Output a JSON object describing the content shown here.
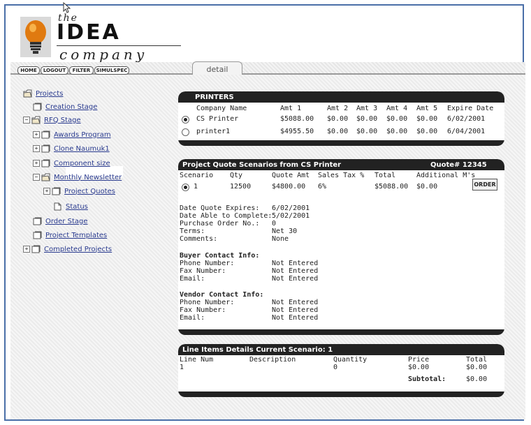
{
  "logo": {
    "the": "the",
    "idea": "IDEA",
    "company": "company"
  },
  "nav": {
    "buttons": [
      "HOME",
      "LOGOUT",
      "FILTER",
      "SIMULSPEC"
    ],
    "tab": "detail"
  },
  "tree": {
    "root": "Projects",
    "items": [
      "Creation Stage",
      "RFQ Stage",
      "Awards Program",
      "Clone Naumuk1",
      "Component size",
      "Monthly Newsletter",
      "Project Quotes",
      "Status",
      "Order Stage",
      "Project Templates",
      "Completed Projects"
    ]
  },
  "printers": {
    "title": "PRINTERS",
    "headers": [
      "Company Name",
      "Amt 1",
      "Amt 2",
      "Amt 3",
      "Amt 4",
      "Amt 5",
      "Expire Date"
    ],
    "rows": [
      [
        "CS Printer",
        "$5088.00",
        "$0.00",
        "$0.00",
        "$0.00",
        "$0.00",
        "6/02/2001"
      ],
      [
        "printer1",
        "$4955.50",
        "$0.00",
        "$0.00",
        "$0.00",
        "$0.00",
        "6/04/2001"
      ]
    ]
  },
  "scenarios": {
    "title": "Project Quote Scenarios from CS Printer",
    "quote_no": "Quote# 12345",
    "headers": [
      "Scenario",
      "Qty",
      "Quote Amt",
      "Sales Tax %",
      "Total",
      "Additional M's"
    ],
    "row": [
      "1",
      "12500",
      "$4800.00",
      "6%",
      "$5088.00",
      "$0.00"
    ],
    "order_label": "ORDER",
    "details": [
      [
        "Date Quote Expires:",
        "6/02/2001"
      ],
      [
        "Date Able to Complete:",
        "5/02/2001"
      ],
      [
        "Purchase Order No.:",
        "0"
      ],
      [
        "Terms:",
        "Net 30"
      ],
      [
        "Comments:",
        "None"
      ]
    ],
    "buyer_title": "Buyer Contact Info:",
    "buyer": [
      [
        "Phone Number:",
        "Not Entered"
      ],
      [
        "Fax Number:",
        "Not Entered"
      ],
      [
        "Email:",
        "Not Entered"
      ]
    ],
    "vendor_title": "Vendor Contact Info:",
    "vendor": [
      [
        "Phone Number:",
        "Not Entered"
      ],
      [
        "Fax Number:",
        "Not Entered"
      ],
      [
        "Email:",
        "Not Entered"
      ]
    ]
  },
  "line_items": {
    "title": "Line Items Details Current Scenario: 1",
    "headers": [
      "Line Num",
      "Description",
      "Quantity",
      "Price",
      "Total"
    ],
    "row": [
      "1",
      "",
      "0",
      "$0.00",
      "$0.00"
    ],
    "subtotal_label": "Subtotal:",
    "subtotal_value": "$0.00"
  }
}
